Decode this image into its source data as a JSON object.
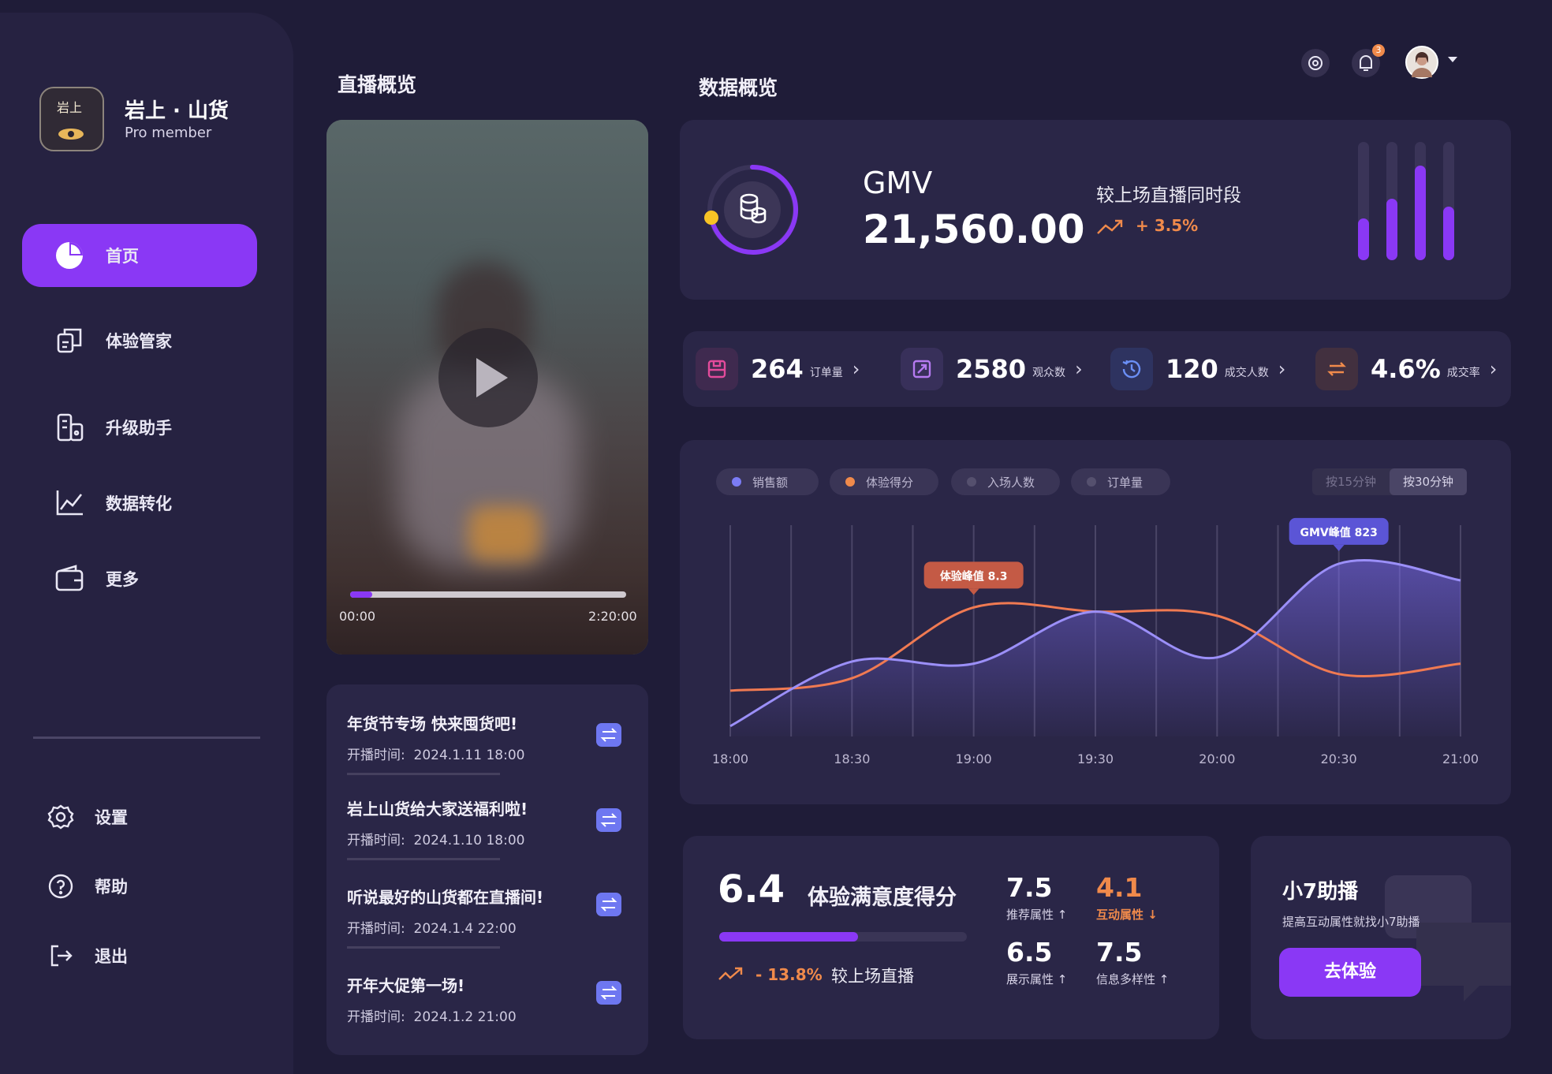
{
  "brand": {
    "name": "岩上 · 山货",
    "subtitle": "Pro member",
    "logo_text": "岩上"
  },
  "nav": {
    "items": [
      {
        "label": "首页",
        "icon": "pie-chart-icon",
        "active": true
      },
      {
        "label": "体验管家",
        "icon": "clipboard-icon"
      },
      {
        "label": "升级助手",
        "icon": "device-grid-icon"
      },
      {
        "label": "数据转化",
        "icon": "line-chart-icon"
      },
      {
        "label": "更多",
        "icon": "wallet-icon"
      }
    ],
    "bottom": [
      {
        "label": "设置",
        "icon": "gear-icon"
      },
      {
        "label": "帮助",
        "icon": "help-circle-icon"
      },
      {
        "label": "退出",
        "icon": "logout-icon"
      }
    ]
  },
  "header": {
    "notification_count": "3"
  },
  "live": {
    "title": "直播概览",
    "video": {
      "time_current": "00:00",
      "time_total": "2:20:00",
      "progress": 0.08
    },
    "sessions": [
      {
        "title": "年货节专场 快来囤货吧!",
        "time_label": "开播时间:",
        "time": "2024.1.11 18:00"
      },
      {
        "title": "岩上山货给大家送福利啦!",
        "time_label": "开播时间:",
        "time": "2024.1.10 18:00"
      },
      {
        "title": "听说最好的山货都在直播间!",
        "time_label": "开播时间:",
        "time": "2024.1.4 22:00"
      },
      {
        "title": "开年大促第一场!",
        "time_label": "开播时间:",
        "time": "2024.1.2 21:00"
      }
    ]
  },
  "overview": {
    "title": "数据概览",
    "gmv": {
      "label": "GMV",
      "value": "21,560.00",
      "compare_label": "较上场直播同时段",
      "change": "+ 3.5%"
    },
    "mini_bars": [
      0.35,
      0.52,
      0.8,
      0.45
    ],
    "stats": [
      {
        "value": "264",
        "unit": "订单量",
        "color": "#e34b9b",
        "bg": "#3f2a4f",
        "icon": "order-icon"
      },
      {
        "value": "2580",
        "unit": "观众数",
        "color": "#b57af0",
        "bg": "#38305a",
        "icon": "viewer-icon"
      },
      {
        "value": "120",
        "unit": "成交人数",
        "color": "#6b8ff5",
        "bg": "#2e3360",
        "icon": "history-icon"
      },
      {
        "value": "4.6%",
        "unit": "成交率",
        "color": "#f08a4b",
        "bg": "#42303f",
        "icon": "exchange-icon"
      }
    ]
  },
  "chart_controls": {
    "legend": [
      {
        "label": "销售额",
        "color": "#7b7cf5"
      },
      {
        "label": "体验得分",
        "color": "#f08a4b"
      },
      {
        "label": "入场人数",
        "color": "#55506e"
      },
      {
        "label": "订单量",
        "color": "#55506e"
      }
    ],
    "toggle": [
      "按15分钟",
      "按30分钟"
    ],
    "toggle_active": 1
  },
  "chart_data": {
    "type": "line",
    "x": [
      "18:00",
      "18:30",
      "19:00",
      "19:30",
      "20:00",
      "20:30",
      "21:00"
    ],
    "series": [
      {
        "name": "体验得分",
        "color": "#f07a52",
        "values": [
          2.2,
          2.8,
          6.2,
          6.0,
          5.8,
          3.0,
          3.5
        ]
      },
      {
        "name": "销售额",
        "color": "#9b8ff8",
        "values": [
          0.5,
          3.6,
          3.5,
          6.0,
          3.8,
          8.3,
          7.5
        ]
      }
    ],
    "annotations": [
      {
        "label": "体验峰值",
        "value": "8.3",
        "series": "体验得分"
      },
      {
        "label": "GMV峰值",
        "value": "823",
        "series": "销售额"
      }
    ],
    "ylim": [
      0,
      10
    ],
    "grid": "vertical"
  },
  "satisfaction": {
    "score": "6.4",
    "label": "体验满意度得分",
    "progress": 0.56,
    "change": "- 13.8%",
    "compare_label": "较上场直播",
    "attributes": [
      {
        "value": "7.5",
        "label": "推荐属性",
        "trend": "up",
        "highlight": false
      },
      {
        "value": "4.1",
        "label": "互动属性",
        "trend": "down",
        "highlight": true
      },
      {
        "value": "6.5",
        "label": "展示属性",
        "trend": "up",
        "highlight": false
      },
      {
        "value": "7.5",
        "label": "信息多样性",
        "trend": "up",
        "highlight": false
      }
    ]
  },
  "assistant": {
    "title": "小7助播",
    "subtitle": "提高互动属性就找小7助播",
    "button": "去体验"
  }
}
